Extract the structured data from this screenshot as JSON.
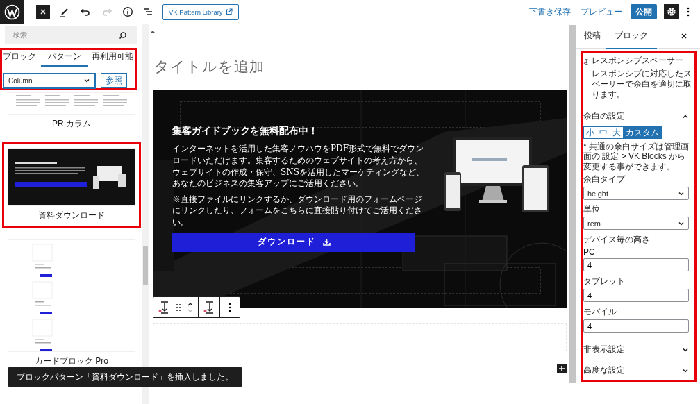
{
  "toolbar": {
    "history": [
      {
        "kind": "undo",
        "disabled": false
      },
      {
        "kind": "redo",
        "disabled": true
      }
    ],
    "library_button": "VK Pattern Library",
    "save_draft": "下書き保存",
    "preview": "プレビュー",
    "publish": "公開"
  },
  "inserter": {
    "search_placeholder": "検索",
    "highlighted": true,
    "tabs": [
      {
        "label": "ブロック",
        "selected": false
      },
      {
        "label": "パターン",
        "selected": true
      },
      {
        "label": "再利用可能",
        "selected": false
      }
    ],
    "category": "Column",
    "browse": "参照",
    "patterns": [
      {
        "label": "PR カラム",
        "kind": "columns",
        "highlighted": false
      },
      {
        "label": "資料ダウンロード",
        "kind": "hero",
        "highlighted": true
      },
      {
        "label": "カードブロック Pro",
        "kind": "cards",
        "highlighted": false
      }
    ]
  },
  "editor": {
    "title_placeholder": "タイトルを追加",
    "hero": {
      "heading": "集客ガイドブックを無料配布中！",
      "body": "インターネットを活用した集客ノウハウをPDF形式で無料でダウンロードいただけます。集客するためのウェブサイトの考え方から、ウェブサイトの作成・保守、SNSを活用したマーケティングなど、あなたのビジネスの集客アップにご活用ください。",
      "note": "※直接ファイルにリンクするか、ダウンロード用のフォームページにリンクしたり、フォームをこちらに直接貼り付けてご活用ください。",
      "button": "ダウンロード"
    }
  },
  "snackbar": "ブロックパターン「資料ダウンロード」を挿入しました。",
  "settings": {
    "highlighted": true,
    "tabs": [
      {
        "label": "投稿",
        "selected": false
      },
      {
        "label": "ブロック",
        "selected": true
      }
    ],
    "block": {
      "title": "レスポンシブスペーサー",
      "description": "レスポンシブに対応したスペーサーで余白を適切に取ります。"
    },
    "panels": [
      {
        "title": "余白の設定",
        "expanded": true
      },
      {
        "title": "非表示設定",
        "expanded": false
      },
      {
        "title": "高度な設定",
        "expanded": false
      }
    ],
    "sizes": [
      {
        "label": "小",
        "selected": false
      },
      {
        "label": "中",
        "selected": false
      },
      {
        "label": "大",
        "selected": false
      },
      {
        "label": "カスタム",
        "selected": true
      }
    ],
    "note": "* 共通の余白サイズは管理画面の 設定 > VK Blocks から変更する事ができます。",
    "fields": [
      {
        "kind": "select",
        "label": "余白タイプ",
        "value": "height"
      },
      {
        "kind": "select",
        "label": "単位",
        "value": "rem"
      },
      {
        "kind": "heading",
        "label": "デバイス毎の高さ"
      },
      {
        "kind": "input",
        "label": "PC",
        "value": "4"
      },
      {
        "kind": "input",
        "label": "タブレット",
        "value": "4"
      },
      {
        "kind": "input",
        "label": "モバイル",
        "value": "4"
      }
    ]
  }
}
